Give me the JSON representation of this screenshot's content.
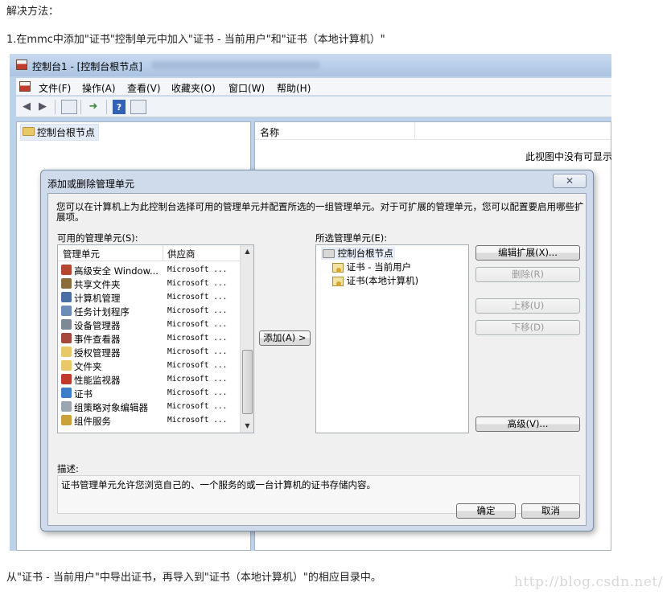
{
  "article": {
    "heading": "解决方法：",
    "step1": "1.在mmc中添加\"证书\"控制单元中加入\"证书 - 当前用户\"和\"证书（本地计算机）\"",
    "footer": "从\"证书 - 当前用户\"中导出证书，再导入到\"证书（本地计算机）\"的相应目录中。",
    "watermark": "http://blog.csdn.net/"
  },
  "mmc": {
    "title": "控制台1 - [控制台根节点]",
    "menu": [
      "文件(F)",
      "操作(A)",
      "查看(V)",
      "收藏夹(O)",
      "窗口(W)",
      "帮助(H)"
    ],
    "tree_root": "控制台根节点",
    "result_column": "名称",
    "empty_message": "此视图中没有可显示"
  },
  "dialog": {
    "title": "添加或删除管理单元",
    "close_glyph": "✕",
    "description": "您可以在计算机上为此控制台选择可用的管理单元并配置所选的一组管理单元。对于可扩展的管理单元，您可以配置要启用哪些扩展项。",
    "available_label": "可用的管理单元(S):",
    "selected_label": "所选管理单元(E):",
    "col_snapin": "管理单元",
    "col_vendor": "供应商",
    "snapins": [
      {
        "name": "高级安全 Window...",
        "vendor": "Microsoft ...",
        "color": "#b5462f"
      },
      {
        "name": "共享文件夹",
        "vendor": "Microsoft ...",
        "color": "#8a6d3b"
      },
      {
        "name": "计算机管理",
        "vendor": "Microsoft ...",
        "color": "#4a6fa5"
      },
      {
        "name": "任务计划程序",
        "vendor": "Microsoft ...",
        "color": "#6c8cb8"
      },
      {
        "name": "设备管理器",
        "vendor": "Microsoft ...",
        "color": "#7d8a96"
      },
      {
        "name": "事件查看器",
        "vendor": "Microsoft ...",
        "color": "#a3483a"
      },
      {
        "name": "授权管理器",
        "vendor": "Microsoft ...",
        "color": "#e8c867"
      },
      {
        "name": "文件夹",
        "vendor": "Microsoft ...",
        "color": "#e8c867"
      },
      {
        "name": "性能监视器",
        "vendor": "Microsoft ...",
        "color": "#c0392b"
      },
      {
        "name": "证书",
        "vendor": "Microsoft ...",
        "color": "#3d7cc9"
      },
      {
        "name": "组策略对象编辑器",
        "vendor": "Microsoft ...",
        "color": "#9aa6b2"
      },
      {
        "name": "组件服务",
        "vendor": "Microsoft ...",
        "color": "#c9a23a"
      }
    ],
    "selected_root": "控制台根节点",
    "selected_children": [
      "证书 - 当前用户",
      "证书(本地计算机)"
    ],
    "add_button": "添加(A) >",
    "edit_ext_button": "编辑扩展(X)...",
    "remove_button": "删除(R)",
    "move_up_button": "上移(U)",
    "move_down_button": "下移(D)",
    "advanced_button": "高级(V)...",
    "desc_label": "描述:",
    "desc_text": "证书管理单元允许您浏览自己的、一个服务的或一台计算机的证书存储内容。",
    "ok_button": "确定",
    "cancel_button": "取消"
  }
}
